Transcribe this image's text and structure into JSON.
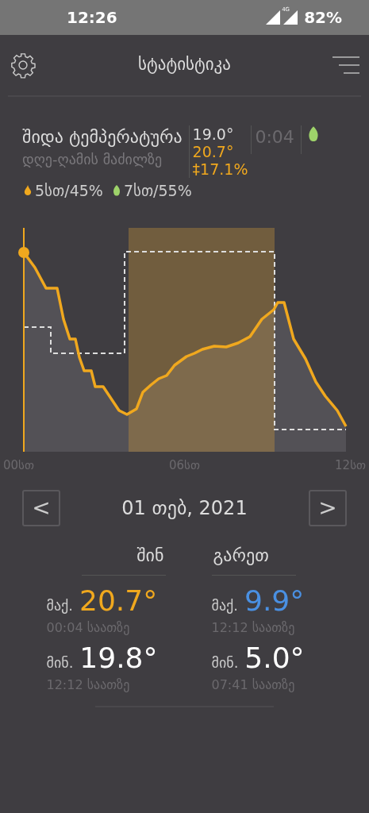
{
  "status_bar": {
    "time": "12:26",
    "network": "4G",
    "battery": "82%"
  },
  "header": {
    "title": "სტატისტიკა"
  },
  "summary": {
    "title": "შიდა ტემპერატურა",
    "subtitle": "დღე-ღამის მაძილზე",
    "readings": [
      {
        "text": "19.0°",
        "kind": "normal"
      },
      {
        "text": "20.7°",
        "kind": "accent"
      },
      {
        "text": "‡17.1%",
        "kind": "accent"
      }
    ],
    "time": "0:04",
    "mode": {
      "kind": "eco"
    },
    "heating": "5სთ/45%",
    "eco": "7სთ/55%"
  },
  "chart": {
    "x_labels": [
      "00სთ",
      "06სთ",
      "12სთ"
    ]
  },
  "date_nav": {
    "prev": "<",
    "date": "01 თებ, 2021",
    "next": ">"
  },
  "stats": [
    {
      "heading": "შინ",
      "max_label": "მაქ.",
      "max": "20.7°",
      "color": "#f0a81e",
      "max_time": "00:04 საათზე",
      "min_label": "მინ.",
      "min": "19.8°",
      "min_time": "12:12 საათზე"
    },
    {
      "heading": "გარეთ",
      "max_label": "მაქ.",
      "max": "9.9°",
      "color": "#4a90e2",
      "max_time": "12:12 საათზე",
      "min_label": "მინ.",
      "min": "5.0°",
      "min_time": "07:41 საათზე"
    }
  ]
}
